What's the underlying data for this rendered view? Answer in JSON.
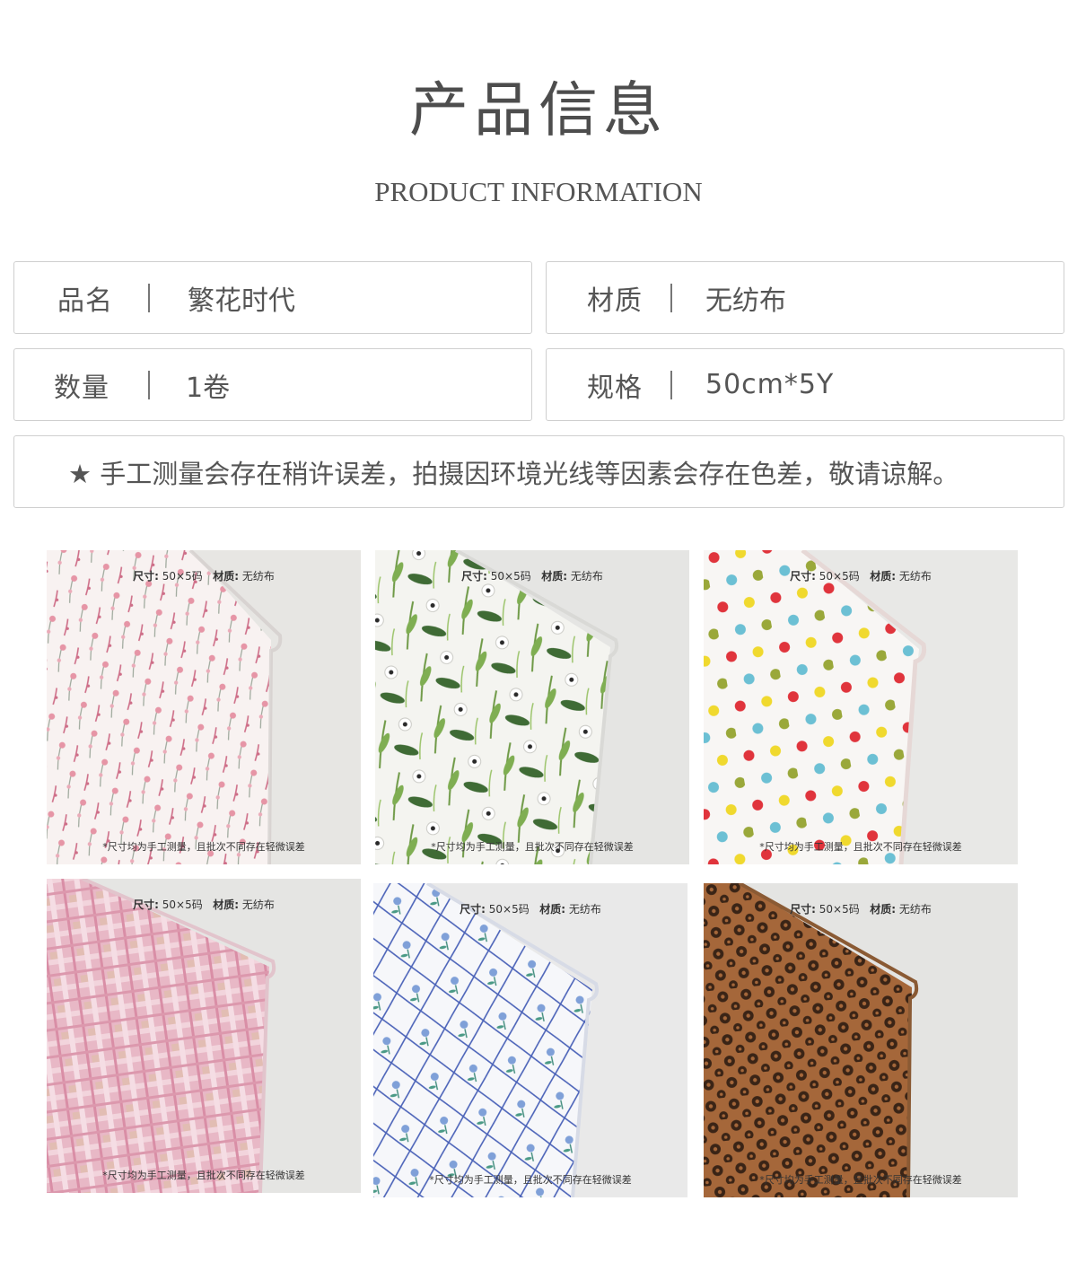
{
  "header": {
    "title_cn": "产品信息",
    "title_en": "PRODUCT INFORMATION"
  },
  "info": {
    "name": {
      "label": "品名",
      "value": "繁花时代"
    },
    "material": {
      "label": "材质",
      "value": "无纺布"
    },
    "quantity": {
      "label": "数量",
      "value": "1卷"
    },
    "spec": {
      "label": "规格",
      "value": "50cm*5Y"
    }
  },
  "note": "★ 手工测量会存在稍许误差，拍摄因环境光线等因素会存在色差，敬请谅解。",
  "photos": [
    {
      "pattern": "pink-floral",
      "size_label": "尺寸:",
      "size_value": "50×5码",
      "material_label": "材质:",
      "material_value": "无纺布",
      "disclaimer": "*尺寸均为手工测量，且批次不同存在轻微误差"
    },
    {
      "pattern": "green-botanical",
      "size_label": "尺寸:",
      "size_value": "50×5码",
      "material_label": "材质:",
      "material_value": "无纺布",
      "disclaimer": "*尺寸均为手工测量，且批次不同存在轻微误差"
    },
    {
      "pattern": "polka-dots",
      "size_label": "尺寸:",
      "size_value": "50×5码",
      "material_label": "材质:",
      "material_value": "无纺布",
      "disclaimer": "*尺寸均为手工测量，且批次不同存在轻微误差"
    },
    {
      "pattern": "pink-plaid",
      "size_label": "尺寸:",
      "size_value": "50×5码",
      "material_label": "材质:",
      "material_value": "无纺布",
      "disclaimer": "*尺寸均为手工测量，且批次不同存在轻微误差"
    },
    {
      "pattern": "blue-lattice",
      "size_label": "尺寸:",
      "size_value": "50×5码",
      "material_label": "材质:",
      "material_value": "无纺布",
      "disclaimer": "*尺寸均为手工测量，且批次不同存在轻微误差"
    },
    {
      "pattern": "brown-damask",
      "size_label": "尺寸:",
      "size_value": "50×5码",
      "material_label": "材质:",
      "material_value": "无纺布",
      "disclaimer": "*尺寸均为手工测量，且批次不同存在轻微误差"
    }
  ]
}
